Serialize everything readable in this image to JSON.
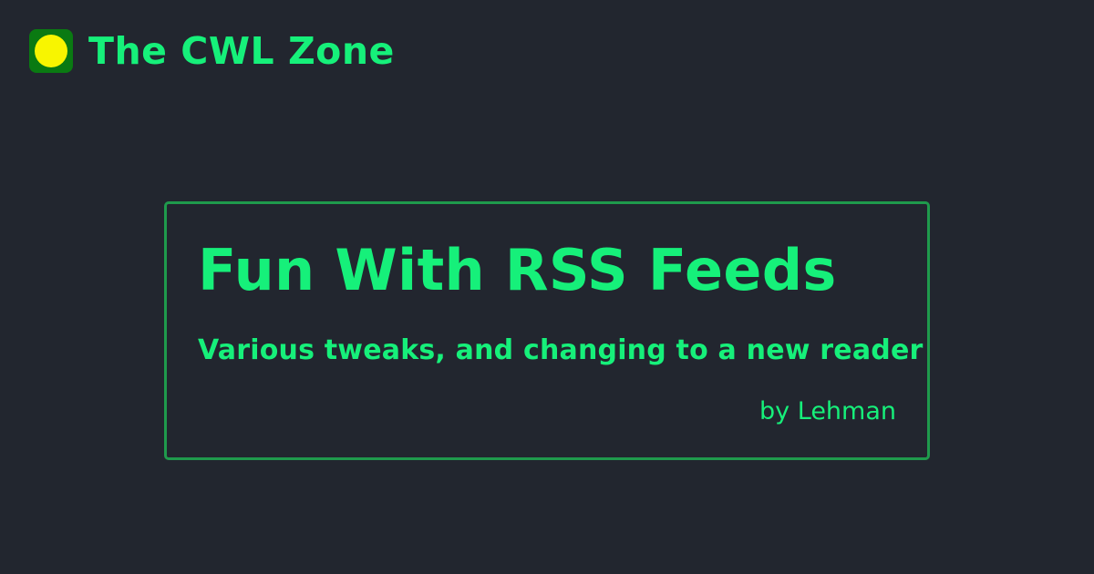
{
  "site": {
    "title": "The CWL Zone",
    "logo": {
      "icon": "yellow-dot-icon",
      "background_color": "#0a7a12",
      "dot_color": "#f8f500"
    }
  },
  "article": {
    "title": "Fun With RSS Feeds",
    "subtitle": "Various tweaks, and changing to a new reader",
    "byline": "by Lehman"
  },
  "colors": {
    "background": "#22262f",
    "accent": "#16f07a",
    "card_border": "#1f9a4c"
  }
}
